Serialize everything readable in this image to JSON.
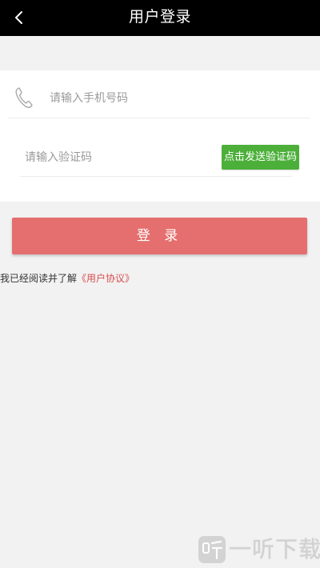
{
  "header": {
    "title": "用户登录",
    "background": "#000000"
  },
  "form": {
    "phone_placeholder": "请输入手机号码",
    "code_placeholder": "请输入验证码",
    "send_code_label": "点击发送验证码",
    "send_code_color": "#4caf3a"
  },
  "login": {
    "label": "登 录",
    "color": "#e46f6e"
  },
  "agreement": {
    "prefix": "我已经阅读并了解",
    "link": "《用户协议》",
    "link_color": "#d74f4f"
  },
  "watermark": {
    "text": "一听下载",
    "icon": "ting-logo-icon"
  }
}
